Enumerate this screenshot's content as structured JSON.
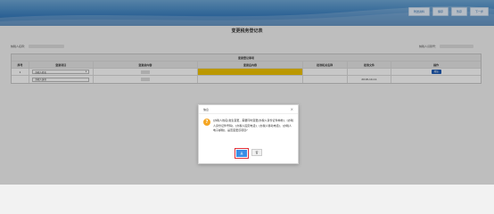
{
  "toolbar": {
    "buttons": [
      "附送资料",
      "保存",
      "暂存",
      "下一步"
    ]
  },
  "form": {
    "title": "变更税务登记表",
    "taxpayer_name_label": "纳税人名称：",
    "taxpayer_id_label": "纳税人识别号："
  },
  "table": {
    "group_header": "变更登记事项",
    "columns": [
      "序号",
      "变更项目",
      "变更前内容",
      "变更后内容",
      "批准机关名称",
      "批准文件",
      "操作"
    ],
    "rows": [
      {
        "index": "1",
        "item": "办税人姓名",
        "after": "",
        "authority": "",
        "doc": "",
        "op": "增加"
      },
      {
        "index": "",
        "item": "办税人身份",
        "after": "",
        "authority": "",
        "doc": "2018-10-11",
        "op": ""
      }
    ]
  },
  "dialog": {
    "title": "信息",
    "close": "×",
    "message": "[办税人姓名]发生变更，需要同时变更[办税人身份证件种类]、[办税人身份证件号码]、[办税人固定电话]、[办税人移动电话]、[办税人电子邮箱]，是否变更该项目?",
    "yes": "是",
    "no": "否"
  },
  "colors": {
    "topbar": "#3a7fc0",
    "yellow_cell": "#f0c300",
    "yes_button": "#3a8ee6",
    "highlight_border": "#e0303a"
  }
}
